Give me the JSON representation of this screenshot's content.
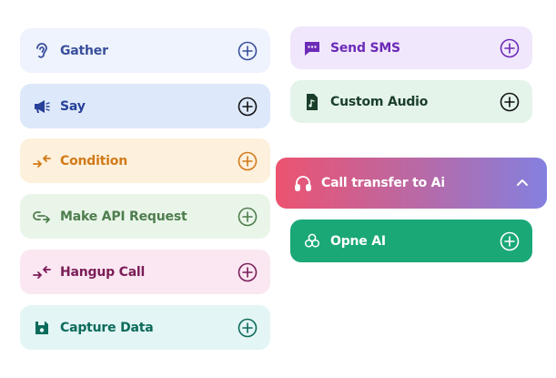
{
  "left_actions": [
    {
      "label": "Gather",
      "icon": "ear-icon"
    },
    {
      "label": "Say",
      "icon": "megaphone-icon"
    },
    {
      "label": "Condition",
      "icon": "condition-arrows-icon"
    },
    {
      "label": "Make API Request",
      "icon": "api-link-icon"
    },
    {
      "label": "Hangup Call",
      "icon": "hangup-arrows-icon"
    },
    {
      "label": "Capture Data",
      "icon": "save-icon"
    }
  ],
  "right_actions": [
    {
      "label": "Send SMS",
      "icon": "sms-icon"
    },
    {
      "label": "Custom Audio",
      "icon": "audio-file-icon"
    }
  ],
  "transfer_group": {
    "label": "Call transfer to Ai",
    "icon": "headphones-icon",
    "toggle_icon": "chevron-up-icon",
    "items": [
      {
        "label": "Opne AI",
        "icon": "openai-icon"
      }
    ]
  },
  "colors": {
    "gather": "#3a4f9c",
    "say": "#27409a",
    "condition": "#d17a18",
    "api": "#4e7d4e",
    "hangup": "#7b1d57",
    "capture": "#0c6b5b",
    "sms": "#6b2bb7",
    "audio": "#1a3e2a",
    "transfer_gradient_start": "#ec5370",
    "transfer_gradient_end": "#8480e0",
    "openai": "#1aa877"
  }
}
